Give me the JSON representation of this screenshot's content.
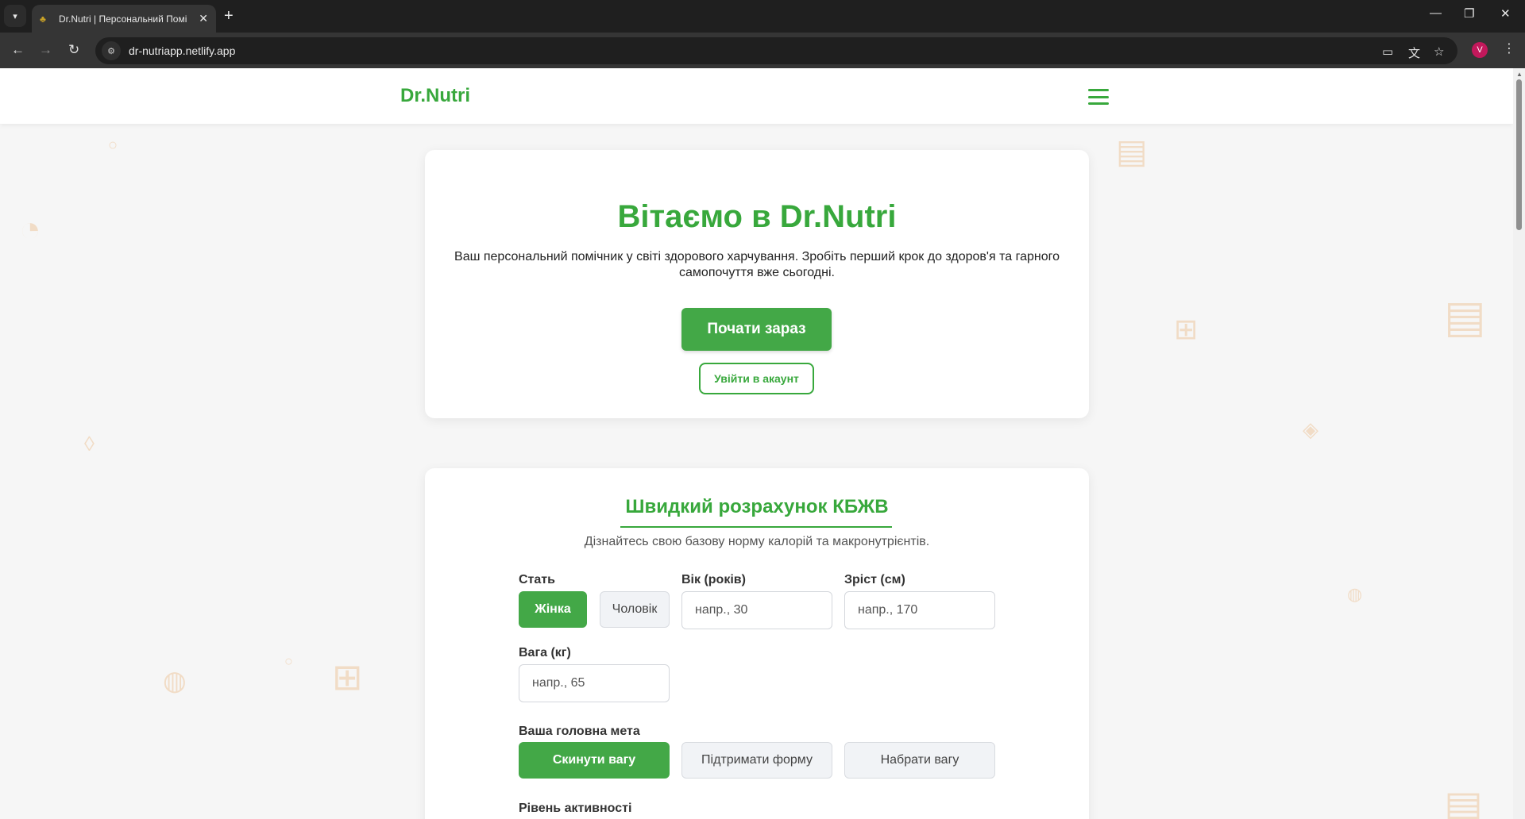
{
  "browser": {
    "tab_title": "Dr.Nutri | Персональний Помі",
    "url": "dr-nutriapp.netlify.app",
    "avatar_letter": "V"
  },
  "header": {
    "logo": "Dr.Nutri"
  },
  "hero": {
    "title": "Вітаємо в Dr.Nutri",
    "description": "Ваш персональний помічник у світі здорового харчування. Зробіть перший крок до здоров'я та гарного самопочуття вже сьогодні.",
    "primary_button": "Почати зараз",
    "secondary_button": "Увійти в акаунт"
  },
  "calculator": {
    "title": "Швидкий розрахунок КБЖВ",
    "subtitle": "Дізнайтесь свою базову норму калорій та макронутрієнтів.",
    "gender": {
      "label": "Стать",
      "options": [
        "Жінка",
        "Чоловік"
      ],
      "selected": "Жінка"
    },
    "age": {
      "label": "Вік (років)",
      "placeholder": "напр., 30"
    },
    "height": {
      "label": "Зріст (см)",
      "placeholder": "напр., 170"
    },
    "weight": {
      "label": "Вага (кг)",
      "placeholder": "напр., 65"
    },
    "goal": {
      "label": "Ваша головна мета",
      "options": [
        "Скинути вагу",
        "Підтримати форму",
        "Набрати вагу"
      ],
      "selected": "Скинути вагу"
    },
    "activity": {
      "label": "Рівень активності"
    }
  },
  "colors": {
    "brand_green": "#38a83c",
    "button_green": "#43a847",
    "decor": "#f1dcc6"
  }
}
